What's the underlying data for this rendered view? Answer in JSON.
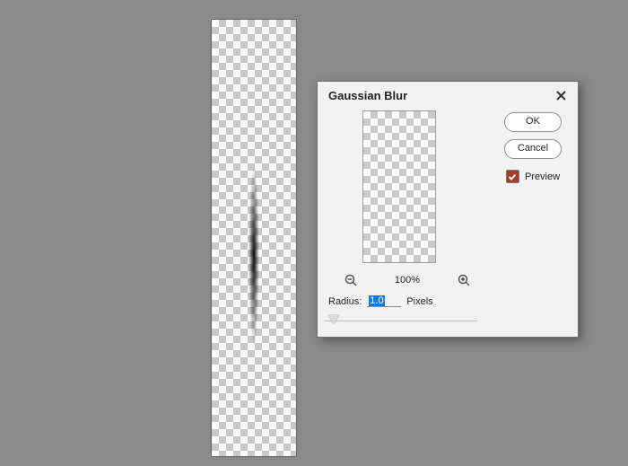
{
  "dialog": {
    "title": "Gaussian Blur",
    "ok": "OK",
    "cancel": "Cancel",
    "preview_label": "Preview",
    "preview_checked": true,
    "zoom_text": "100%",
    "radius_label": "Radius:",
    "radius_value": "1.0",
    "radius_unit": "Pixels"
  }
}
